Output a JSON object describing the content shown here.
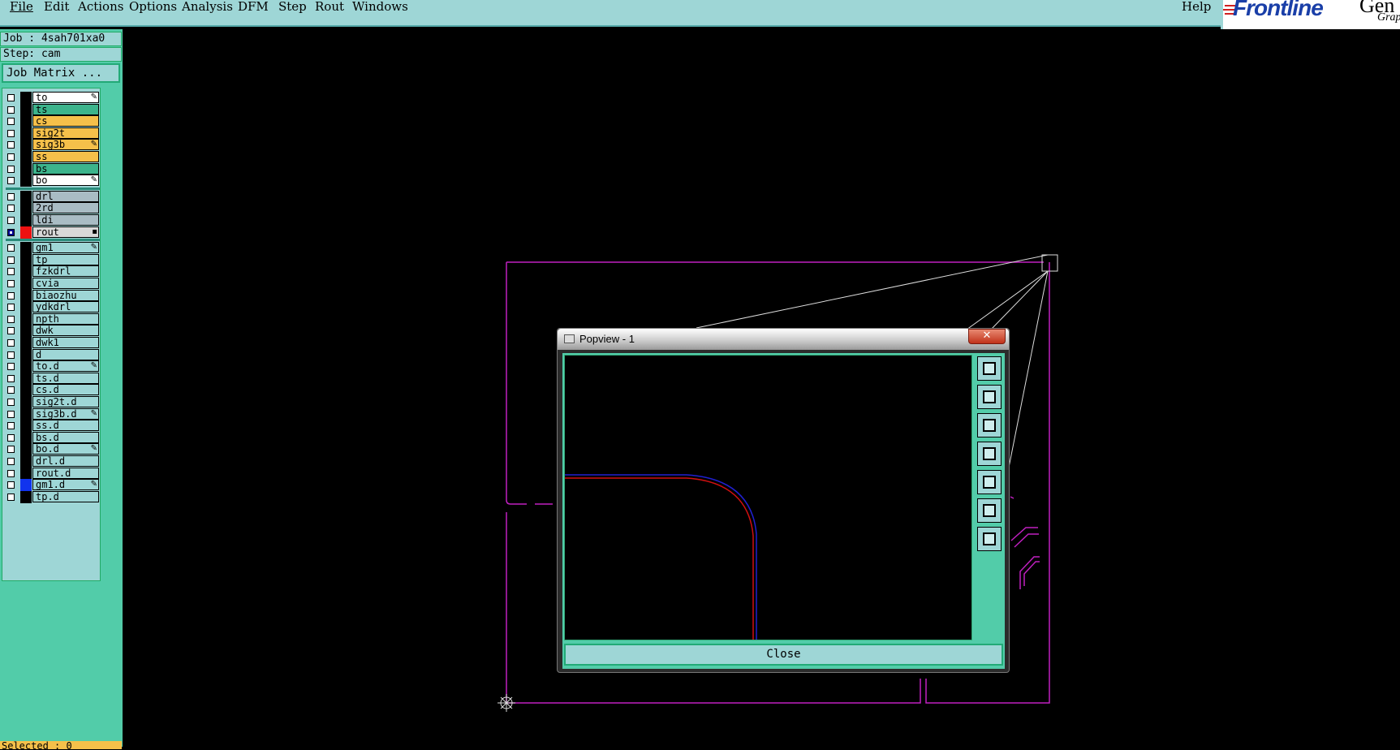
{
  "menubar": {
    "items": [
      "File",
      "Edit",
      "Actions",
      "Options",
      "Analysis",
      "DFM",
      "Step",
      "Rout",
      "Windows"
    ],
    "help": "Help"
  },
  "logo": {
    "brand": "Frontline",
    "brand_cut": "Gen",
    "sub": "Grap"
  },
  "job": {
    "job_label": "Job : 4sah701xa0",
    "step_label": "Step: cam",
    "matrix_button": "Job Matrix ..."
  },
  "layers": [
    {
      "name": "to",
      "color": "#ffffff",
      "marker": "✎",
      "sep_after": false
    },
    {
      "name": "ts",
      "color": "#3cb48c",
      "marker": "",
      "sep_after": false
    },
    {
      "name": "cs",
      "color": "#f5c04a",
      "marker": "",
      "sep_after": false
    },
    {
      "name": "sig2t",
      "color": "#f5c04a",
      "marker": "",
      "sep_after": false
    },
    {
      "name": "sig3b",
      "color": "#f5c04a",
      "marker": "✎",
      "sep_after": false
    },
    {
      "name": "ss",
      "color": "#f5c04a",
      "marker": "",
      "sep_after": false
    },
    {
      "name": "bs",
      "color": "#3cb48c",
      "marker": "",
      "sep_after": false
    },
    {
      "name": "bo",
      "color": "#ffffff",
      "marker": "✎",
      "sep_after": true
    },
    {
      "name": "drl",
      "color": "#a9bcc4",
      "marker": "",
      "sep_after": false
    },
    {
      "name": "2rd",
      "color": "#a9bcc4",
      "marker": "",
      "sep_after": false
    },
    {
      "name": "ldi",
      "color": "#a9bcc4",
      "marker": "",
      "sep_after": false
    },
    {
      "name": "rout",
      "color": "#d8d8d8",
      "marker": "▪",
      "active": true,
      "swatch": "#ee1111",
      "sep_after": true
    },
    {
      "name": "gm1",
      "color": "#9ed6d6",
      "marker": "✎",
      "sep_after": false
    },
    {
      "name": "tp",
      "color": "#9ed6d6",
      "marker": "",
      "sep_after": false
    },
    {
      "name": "fzkdrl",
      "color": "#9ed6d6",
      "marker": "",
      "sep_after": false
    },
    {
      "name": "cvia",
      "color": "#9ed6d6",
      "marker": "",
      "sep_after": false
    },
    {
      "name": "biaozhu",
      "color": "#9ed6d6",
      "marker": "",
      "sep_after": false
    },
    {
      "name": "ydkdrl",
      "color": "#9ed6d6",
      "marker": "",
      "sep_after": false
    },
    {
      "name": "npth",
      "color": "#9ed6d6",
      "marker": "",
      "sep_after": false
    },
    {
      "name": "dwk",
      "color": "#9ed6d6",
      "marker": "",
      "sep_after": false
    },
    {
      "name": "dwk1",
      "color": "#9ed6d6",
      "marker": "",
      "sep_after": false
    },
    {
      "name": "d",
      "color": "#9ed6d6",
      "marker": "",
      "sep_after": false
    },
    {
      "name": "to.d",
      "color": "#9ed6d6",
      "marker": "✎",
      "sep_after": false
    },
    {
      "name": "ts.d",
      "color": "#9ed6d6",
      "marker": "",
      "sep_after": false
    },
    {
      "name": "cs.d",
      "color": "#9ed6d6",
      "marker": "",
      "sep_after": false
    },
    {
      "name": "sig2t.d",
      "color": "#9ed6d6",
      "marker": "",
      "sep_after": false
    },
    {
      "name": "sig3b.d",
      "color": "#9ed6d6",
      "marker": "✎",
      "sep_after": false
    },
    {
      "name": "ss.d",
      "color": "#9ed6d6",
      "marker": "",
      "sep_after": false
    },
    {
      "name": "bs.d",
      "color": "#9ed6d6",
      "marker": "",
      "sep_after": false
    },
    {
      "name": "bo.d",
      "color": "#9ed6d6",
      "marker": "✎",
      "sep_after": false
    },
    {
      "name": "drl.d",
      "color": "#9ed6d6",
      "marker": "",
      "sep_after": false
    },
    {
      "name": "rout.d",
      "color": "#9ed6d6",
      "marker": "",
      "sep_after": false
    },
    {
      "name": "gm1.d",
      "color": "#9ed6d6",
      "marker": "✎",
      "swatch": "#1133ee",
      "sep_after": false
    },
    {
      "name": "tp.d",
      "color": "#9ed6d6",
      "marker": "",
      "sep_after": false
    }
  ],
  "status": {
    "selected": "Selected : 0"
  },
  "popview": {
    "title": "Popview - 1",
    "close_x": "✕",
    "close_button": "Close",
    "tools": [
      "zoom-window-icon",
      "pan-up-icon",
      "pan-down-icon",
      "pan-left-icon",
      "pan-right-icon",
      "zoom-fit-icon",
      "zoom-home-icon"
    ]
  },
  "colors": {
    "outline": "#c020c0",
    "rout_path": "#d01010",
    "comp_path": "#2020d0",
    "panel": "#52cca9",
    "field": "#9ed6d6"
  }
}
